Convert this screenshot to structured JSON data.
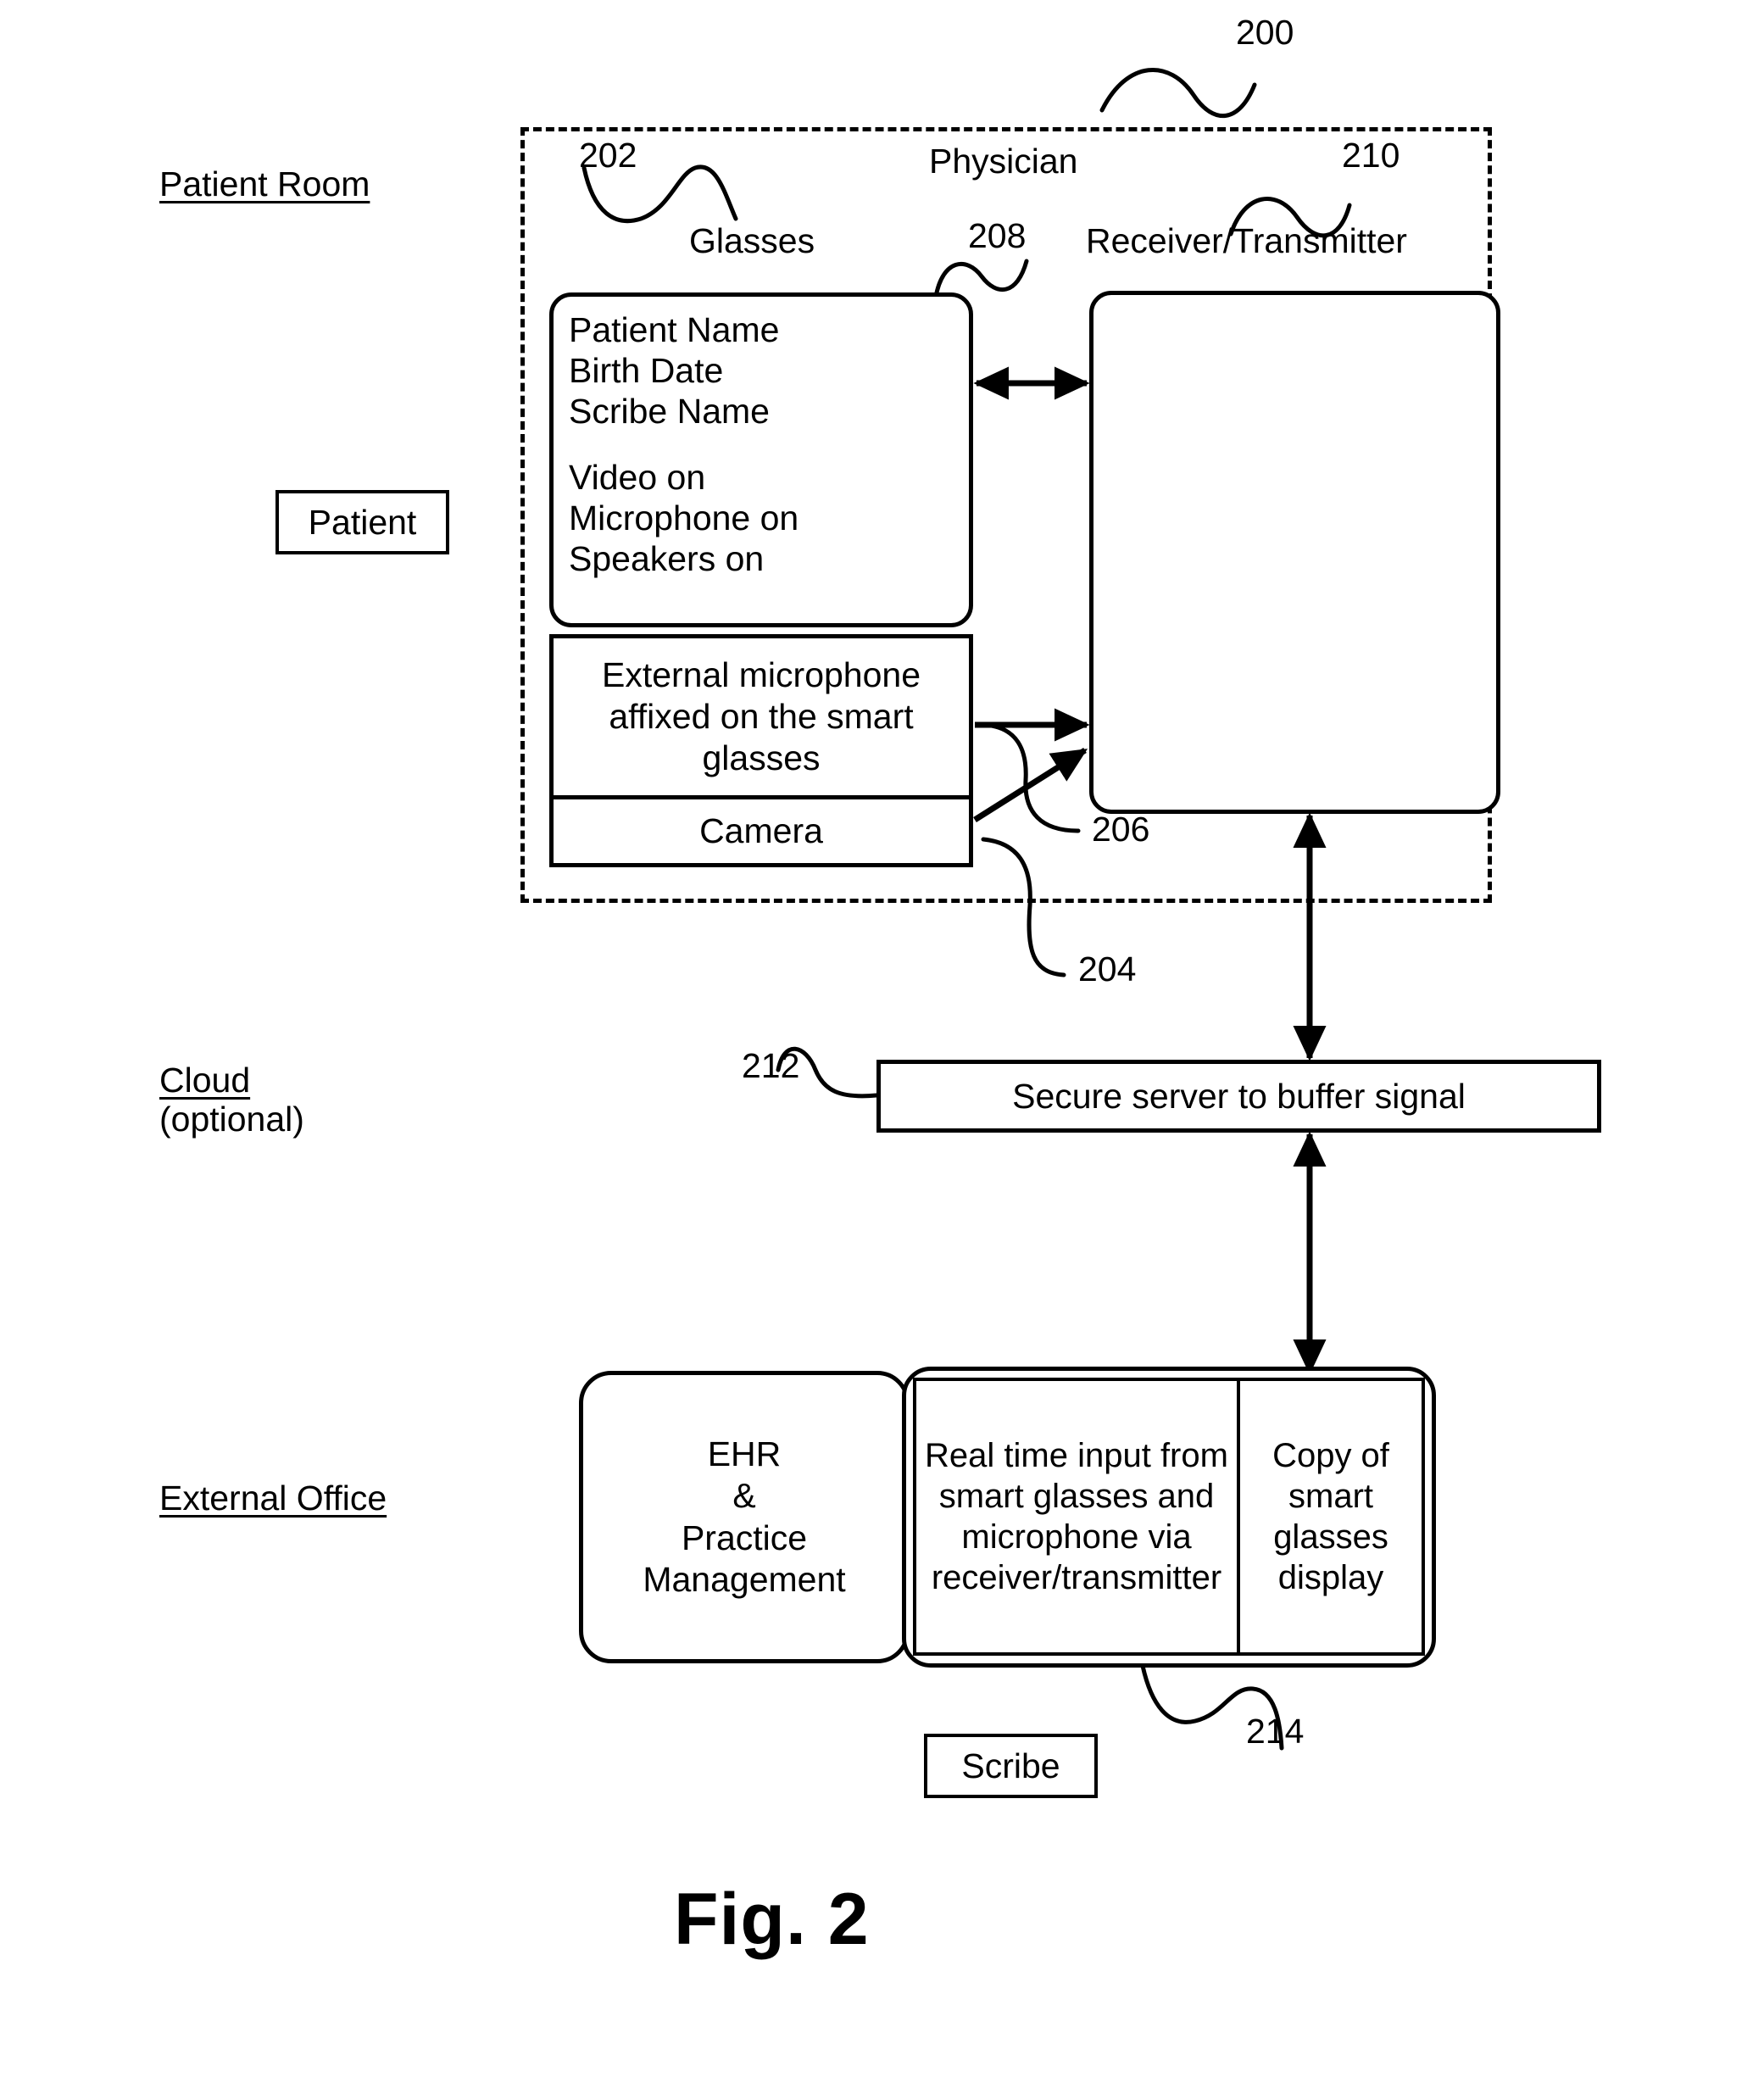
{
  "figure": {
    "caption": "Fig. 2",
    "system_ref": "200"
  },
  "sections": [
    {
      "name": "patient-room",
      "label": "Patient Room",
      "sublabel": ""
    },
    {
      "name": "cloud",
      "label": "Cloud",
      "sublabel": "(optional)"
    },
    {
      "name": "external-office",
      "label": "External Office",
      "sublabel": ""
    }
  ],
  "actors": {
    "patient": "Patient",
    "physician": "Physician",
    "scribe": "Scribe"
  },
  "patient_room": {
    "ref_glasses": "202",
    "label_glasses": "Glasses",
    "ref_link": "208",
    "ref_receiver": "210",
    "label_receiver": "Receiver/Transmitter",
    "ref_camera": "204",
    "ref_microphone": "206",
    "glasses_display_lines": [
      "Patient Name",
      "Birth Date",
      "Scribe Name",
      "",
      "Video on",
      "Microphone on",
      "Speakers on"
    ],
    "microphone_box": "External microphone affixed on the smart glasses",
    "camera_box": "Camera",
    "receiver_box": ""
  },
  "cloud": {
    "ref_server": "212",
    "server_label": "Secure server to buffer signal"
  },
  "external_office": {
    "ref_workstation": "214",
    "ehr_label": "EHR\n&\nPractice\nManagement",
    "ehr_lines": [
      "EHR",
      "&",
      "Practice",
      "Management"
    ],
    "realtime_input": "Real time input from smart glasses and microphone via receiver/transmitter",
    "glasses_copy": "Copy of smart glasses display"
  },
  "colors": {
    "stroke": "#000000",
    "background": "#ffffff"
  }
}
